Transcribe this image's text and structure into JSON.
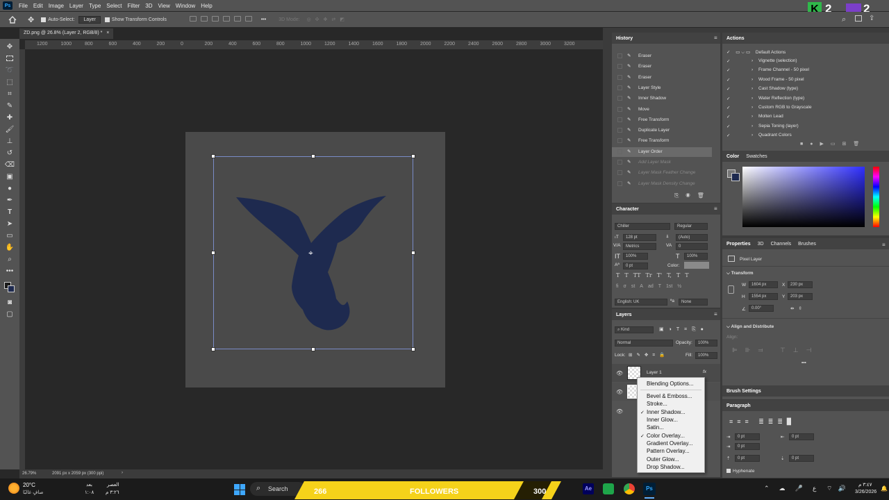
{
  "menu": {
    "items": [
      "File",
      "Edit",
      "Image",
      "Layer",
      "Type",
      "Select",
      "Filter",
      "3D",
      "View",
      "Window",
      "Help"
    ]
  },
  "options": {
    "auto_select_label": "Auto-Select:",
    "auto_select_value": "Layer",
    "transform_label": "Show Transform Controls",
    "mode_3d": "3D Mode:",
    "more": "•••"
  },
  "topright": {
    "k_badge": "K",
    "k_count": "2",
    "u_count": "2"
  },
  "doc_tab": {
    "title": "ZD.png @ 26.8% (Layer 2, RGB/8) *",
    "close": "×"
  },
  "ruler": {
    "marks": [
      "1200",
      "1000",
      "800",
      "600",
      "400",
      "200",
      "0",
      "200",
      "400",
      "600",
      "800",
      "1000",
      "1200",
      "1400",
      "1600",
      "1800",
      "2000",
      "2200",
      "2400",
      "2600",
      "2800",
      "3000",
      "3200"
    ]
  },
  "status": {
    "zoom": "26.79%",
    "doc_info": "2091 px x 2059 px (300 ppi)",
    "arrow": "›"
  },
  "history": {
    "title": "History",
    "items": [
      {
        "label": "Eraser",
        "muted": false
      },
      {
        "label": "Eraser",
        "muted": false
      },
      {
        "label": "Eraser",
        "muted": false
      },
      {
        "label": "Layer Style",
        "muted": false
      },
      {
        "label": "Inner Shadow",
        "muted": false
      },
      {
        "label": "Move",
        "muted": false
      },
      {
        "label": "Free Transform",
        "muted": false
      },
      {
        "label": "Duplicate Layer",
        "muted": false
      },
      {
        "label": "Free Transform",
        "muted": false
      },
      {
        "label": "Layer Order",
        "muted": false
      },
      {
        "label": "Add Layer Mask",
        "muted": true
      },
      {
        "label": "Layer Mask Feather Change",
        "muted": true
      },
      {
        "label": "Layer Mask Density Change",
        "muted": true
      }
    ]
  },
  "actions": {
    "title": "Actions",
    "set": "Default Actions",
    "items": [
      "Vignette (selection)",
      "Frame Channel - 50 pixel",
      "Wood Frame - 50 pixel",
      "Cast Shadow (type)",
      "Water Reflection (type)",
      "Custom RGB to Grayscale",
      "Molten Lead",
      "Sepia Toning (layer)",
      "Quadrant Colors"
    ]
  },
  "color_panel": {
    "tabs": [
      "Color",
      "Swatches"
    ]
  },
  "character": {
    "title": "Character",
    "font": "Chiller",
    "style": "Regular",
    "size": "128 pt",
    "leading": "(Auto)",
    "kerning": "Metrics",
    "tracking": "0",
    "vscale": "100%",
    "hscale": "100%",
    "baseline": "0 pt",
    "color_label": "Color:",
    "language": "English: UK",
    "aa": "None",
    "text_style_buttons": [
      "T",
      "T",
      "TT",
      "Tr",
      "T'",
      "T,",
      "T",
      "T"
    ],
    "opentype_buttons": [
      "fi",
      "σ",
      "st",
      "A",
      "ad",
      "T",
      "1st",
      "½"
    ]
  },
  "properties": {
    "tabs": [
      "Properties",
      "3D",
      "Channels",
      "Brushes"
    ],
    "kind": "Pixel Layer",
    "transform_label": "Transform",
    "w_label": "W",
    "w": "1604 px",
    "h_label": "H",
    "h": "1554 px",
    "x_label": "X",
    "x": "230 px",
    "y_label": "Y",
    "y": "203 px",
    "angle": "0.00°",
    "align_label": "Align and Distribute",
    "align_sub": "Align:",
    "more": "•••"
  },
  "brush_settings": {
    "title": "Brush Settings"
  },
  "paragraph": {
    "title": "Paragraph",
    "fields": [
      "0 pt",
      "0 pt",
      "0 pt",
      "0 pt",
      "0 pt"
    ],
    "hyphenate": "Hyphenate"
  },
  "layers": {
    "title": "Layers",
    "kind": "Kind",
    "blend": "Normal",
    "opacity_label": "Opacity:",
    "opacity": "100%",
    "lock_label": "Lock:",
    "fill_label": "Fill:",
    "fill": "100%",
    "layer1": "Layer 1",
    "fx": "fx"
  },
  "context_menu": {
    "items": [
      {
        "label": "Blending Options...",
        "checked": false
      },
      {
        "label": "Bevel & Emboss...",
        "checked": false
      },
      {
        "label": "Stroke...",
        "checked": false
      },
      {
        "label": "Inner Shadow...",
        "checked": true
      },
      {
        "label": "Inner Glow...",
        "checked": false
      },
      {
        "label": "Satin...",
        "checked": false
      },
      {
        "label": "Color Overlay...",
        "checked": true
      },
      {
        "label": "Gradient Overlay...",
        "checked": false
      },
      {
        "label": "Pattern Overlay...",
        "checked": false
      },
      {
        "label": "Outer Glow...",
        "checked": false
      },
      {
        "label": "Drop Shadow...",
        "checked": false
      }
    ]
  },
  "taskbar": {
    "weather_temp": "20°C",
    "weather_desc": "صافٍ غالبًا",
    "prayer_label": "بعد",
    "prayer_time": "١:٠٨",
    "prayer_name": "العصر",
    "prayer_clock": "٣:٢٦ م",
    "search": "Search",
    "banner_left": "266",
    "banner_mid": "FOLLOWERS",
    "banner_right": "300",
    "lang": "ع",
    "clock_time": "٣:٤٧ م",
    "clock_date": "3/26/2026"
  },
  "colors": {
    "accent": "#31a8ff",
    "dragon": "#1e2a4f",
    "canvas": "#4a4a4a",
    "banner": "#f5d21a"
  }
}
